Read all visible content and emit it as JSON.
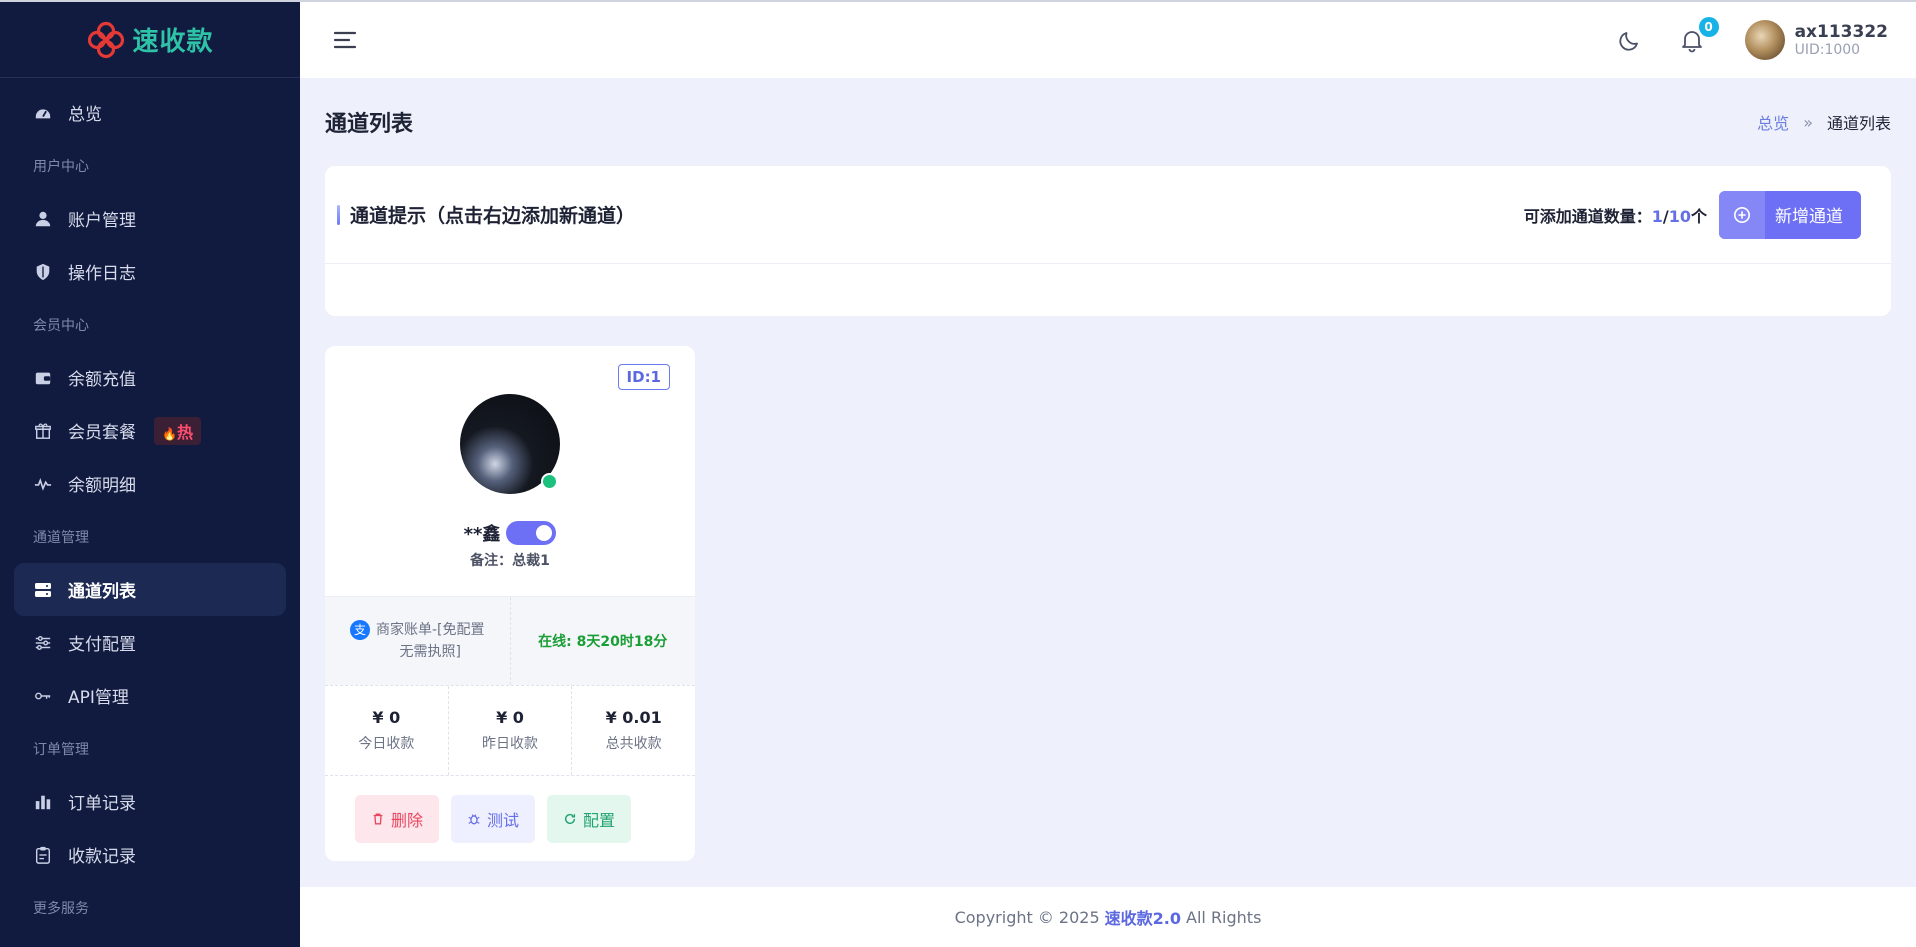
{
  "brand": {
    "name": "速收款",
    "colors": {
      "sidebar": "#111b3f",
      "accent": "#6d70f5",
      "logo_green": "#2ec2a7",
      "logo_red": "#e53935"
    }
  },
  "sidebar": {
    "items": [
      {
        "type": "link",
        "label": "总览",
        "icon": "dashboard-icon"
      },
      {
        "type": "section",
        "label": "用户中心"
      },
      {
        "type": "link",
        "label": "账户管理",
        "icon": "user-icon"
      },
      {
        "type": "link",
        "label": "操作日志",
        "icon": "shield-icon"
      },
      {
        "type": "section",
        "label": "会员中心"
      },
      {
        "type": "link",
        "label": "余额充值",
        "icon": "wallet-icon"
      },
      {
        "type": "link",
        "label": "会员套餐",
        "icon": "gift-icon",
        "badge": "热"
      },
      {
        "type": "link",
        "label": "余额明细",
        "icon": "pulse-icon"
      },
      {
        "type": "section",
        "label": "通道管理"
      },
      {
        "type": "link",
        "label": "通道列表",
        "icon": "server-icon",
        "active": true
      },
      {
        "type": "link",
        "label": "支付配置",
        "icon": "sliders-icon"
      },
      {
        "type": "link",
        "label": "API管理",
        "icon": "key-icon"
      },
      {
        "type": "section",
        "label": "订单管理"
      },
      {
        "type": "link",
        "label": "订单记录",
        "icon": "bar-chart-icon"
      },
      {
        "type": "link",
        "label": "收款记录",
        "icon": "clipboard-icon"
      },
      {
        "type": "section",
        "label": "更多服务"
      }
    ]
  },
  "header": {
    "notifications": "0",
    "user": {
      "name": "ax113322",
      "uid": "UID:1000"
    }
  },
  "page": {
    "title": "通道列表",
    "breadcrumb": {
      "home": "总览",
      "sep": "»",
      "current": "通道列表"
    }
  },
  "tip": {
    "title": "通道提示（点击右边添加新通道）",
    "quota_label": "可添加通道数量：",
    "quota_used": "1",
    "quota_slash": "/",
    "quota_total": "10",
    "quota_unit": "个",
    "add_button": "新增通道"
  },
  "channel": {
    "id": "ID:1",
    "name": "**鑫",
    "enabled": true,
    "note": "备注：总裁1",
    "merchant": "商家账单-[免配置无需执照]",
    "merchant_line1": "商家账单-[免配置",
    "merchant_line2": "无需执照]",
    "online": "在线: 8天20时18分",
    "stats": [
      {
        "value": "¥ 0",
        "label": "今日收款"
      },
      {
        "value": "¥ 0",
        "label": "昨日收款"
      },
      {
        "value": "¥ 0.01",
        "label": "总共收款"
      }
    ],
    "actions": {
      "delete": "删除",
      "test": "测试",
      "config": "配置"
    }
  },
  "footer": {
    "prefix": "Copyright © 2025",
    "brand": "速收款2.0",
    "suffix": "All Rights"
  }
}
